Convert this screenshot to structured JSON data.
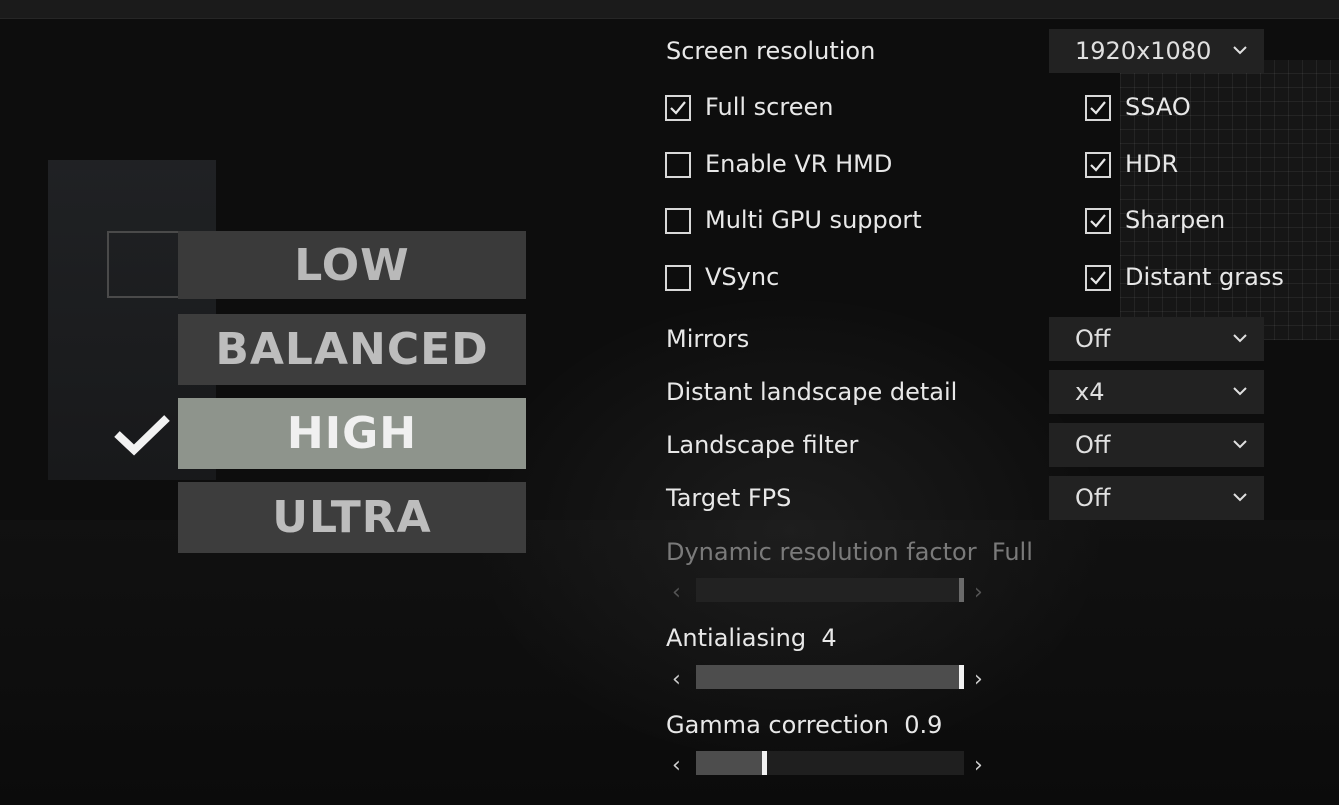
{
  "presets": {
    "low": "LOW",
    "balanced": "BALANCED",
    "high": "HIGH",
    "ultra": "ULTRA",
    "selected": "HIGH"
  },
  "settings": {
    "screen_resolution": {
      "label": "Screen resolution",
      "value": "1920x1080"
    },
    "checkboxes_left": [
      {
        "label": "Full screen",
        "checked": true
      },
      {
        "label": "Enable VR HMD",
        "checked": false
      },
      {
        "label": "Multi GPU support",
        "checked": false
      },
      {
        "label": "VSync",
        "checked": false
      }
    ],
    "checkboxes_right": [
      {
        "label": "SSAO",
        "checked": true
      },
      {
        "label": "HDR",
        "checked": true
      },
      {
        "label": "Sharpen",
        "checked": true
      },
      {
        "label": "Distant grass",
        "checked": true
      }
    ],
    "mirrors": {
      "label": "Mirrors",
      "value": "Off"
    },
    "distant_landscape": {
      "label": "Distant landscape detail",
      "value": "x4"
    },
    "landscape_filter": {
      "label": "Landscape filter",
      "value": "Off"
    },
    "target_fps": {
      "label": "Target FPS",
      "value": "Off"
    },
    "dynamic_resolution": {
      "label": "Dynamic resolution factor",
      "value": "Full",
      "level": 1.0,
      "enabled": false
    },
    "antialiasing": {
      "label": "Antialiasing",
      "value": "4",
      "level": 1.0
    },
    "gamma": {
      "label": "Gamma correction",
      "value": "0.9",
      "level": 0.25
    }
  },
  "colors": {
    "preset_active": "#8e948c",
    "preset_inactive": "#3d3d3d",
    "dropdown_bg": "#222222"
  },
  "icons": {
    "check": "check-icon",
    "chevron": "chevron-down-icon",
    "arrow_left": "chevron-left-icon",
    "arrow_right": "chevron-right-icon"
  }
}
